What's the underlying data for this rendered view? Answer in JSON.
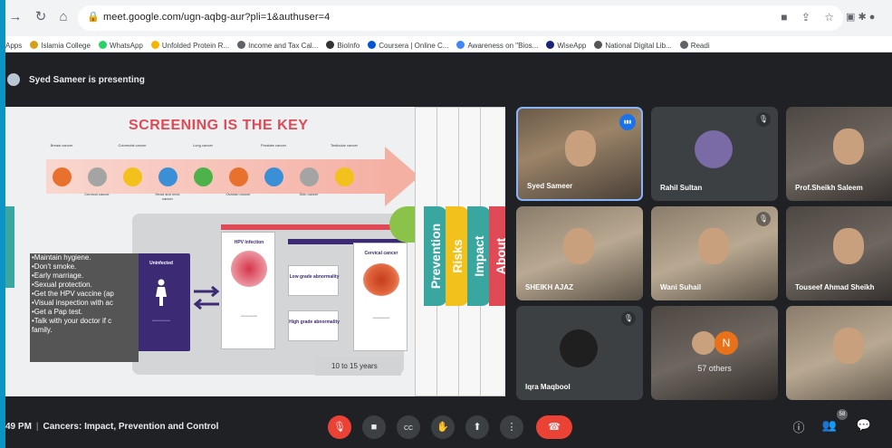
{
  "browser": {
    "url": "meet.google.com/ugn-aqbg-aur?pli=1&authuser=4",
    "bookmarks": [
      {
        "label": "Apps",
        "color": "#4285f4"
      },
      {
        "label": "Islamia College",
        "color": "#d4a017"
      },
      {
        "label": "WhatsApp",
        "color": "#25d366"
      },
      {
        "label": "Unfolded Protein R...",
        "color": "#f4b400"
      },
      {
        "label": "Income and Tax Cal...",
        "color": "#5f6368"
      },
      {
        "label": "BioInfo",
        "color": "#333333"
      },
      {
        "label": "Coursera | Online C...",
        "color": "#0056d2"
      },
      {
        "label": "Awareness on \"Bios...",
        "color": "#4285f4"
      },
      {
        "label": "WiseApp",
        "color": "#1a237e"
      },
      {
        "label": "National Digital Lib...",
        "color": "#555555"
      },
      {
        "label": "Readi",
        "color": "#5f6368"
      }
    ]
  },
  "meet": {
    "presenting_text": "Syed Sameer is presenting",
    "meeting_time": "49 PM",
    "meeting_title": "Cancers: Impact, Prevention and Control"
  },
  "slide": {
    "title": "SCREENING IS THE KEY",
    "timeline_top": [
      {
        "label": "Breast cancer",
        "color": "#e8712d"
      },
      {
        "label": "Colorectal cancer",
        "color": "#f2c11b"
      },
      {
        "label": "Lung cancer",
        "color": "#4db24a"
      },
      {
        "label": "Prostate cancer",
        "color": "#3b8fd6"
      },
      {
        "label": "Testicular cancer",
        "color": "#f2c11b"
      }
    ],
    "timeline_bottom": [
      {
        "label": "Cervical cancer",
        "color": "#a4a4a4"
      },
      {
        "label": "Head and neck cancer",
        "color": "#3b8fd6"
      },
      {
        "label": "Ovarian cancer",
        "color": "#e8712d"
      },
      {
        "label": "Skin cancer",
        "color": "#a4a4a4"
      }
    ],
    "tips": [
      "•Maintain hygiene.",
      "•Don't smoke.",
      "•Early marriage.",
      "•Sexual protection.",
      "•Get the HPV vaccine (ap",
      "•Visual inspection with ac",
      "•Get a Pap test.",
      "•Talk with your doctor if c",
      "family."
    ],
    "uninfected_label": "Uninfected",
    "hpv_label": "HPV Infection",
    "low_grade_label": "Low grade abnormality",
    "high_grade_label": "High grade abnormality",
    "cervical_cancer_label": "Cervical cancer",
    "years_label": "10 to 15 years",
    "tabs": [
      {
        "label": "Prevention",
        "color": "#3aa6a0"
      },
      {
        "label": "Risks",
        "color": "#f2c11b"
      },
      {
        "label": "Impact",
        "color": "#3aa6a0"
      },
      {
        "label": "About",
        "color": "#e04a56"
      }
    ]
  },
  "participants": [
    {
      "name": "Syed Sameer",
      "status": "speaking"
    },
    {
      "name": "Rahil Sultan",
      "status": "muted"
    },
    {
      "name": "Prof.Sheikh Saleem",
      "status": "video"
    },
    {
      "name": "SHEIKH AJAZ",
      "status": "video"
    },
    {
      "name": "Wani Suhail",
      "status": "muted"
    },
    {
      "name": "Touseef Ahmad Sheikh",
      "status": "video"
    },
    {
      "name": "Iqra Maqbool",
      "status": "muted"
    },
    {
      "name": "57 others",
      "avatar_letter": "N"
    },
    {
      "name": "",
      "status": "video"
    }
  ],
  "controls": {
    "participant_count": "58"
  },
  "icons": {
    "back": "←",
    "forward": "→",
    "reload": "↻",
    "home": "⌂",
    "lock": "🔒",
    "mic_off": "🎙",
    "camera": "📷",
    "captions": "CC",
    "raise_hand": "✋",
    "present": "⬆",
    "more": "⋮",
    "end_call": "☎",
    "info": "ⓘ",
    "people": "👥",
    "chat": "💬"
  }
}
